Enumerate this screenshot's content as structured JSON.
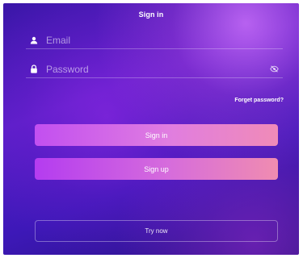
{
  "header": {
    "title": "Sign in"
  },
  "form": {
    "email_placeholder": "Email",
    "email_icon": "user-icon",
    "password_placeholder": "Password",
    "password_icon": "lock-icon",
    "visibility_icon": "eye-off-icon",
    "forgot_label": "Forget password?"
  },
  "actions": {
    "signin_label": "Sign in",
    "signup_label": "Sign up",
    "try_label": "Try now"
  },
  "colors": {
    "background_top": "#5a1fc9",
    "background_bottom": "#2a1280",
    "button_gradient_start": "#c24ff0",
    "button_gradient_end": "#f08bb8",
    "text": "#ffffff"
  }
}
